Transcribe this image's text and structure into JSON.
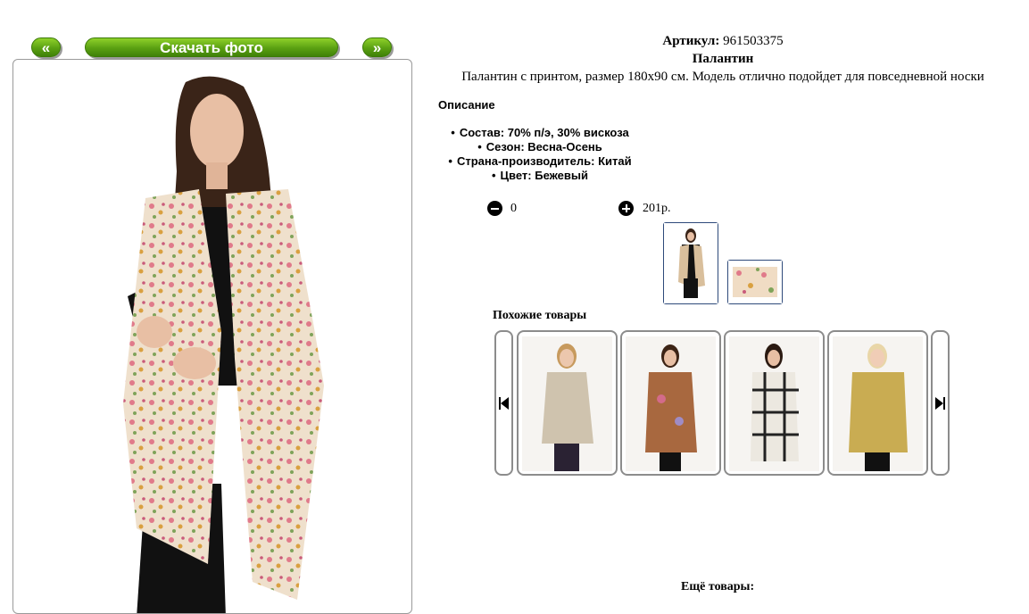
{
  "nav": {
    "prev_label": "«",
    "download_label": "Скачать фото",
    "next_label": "»"
  },
  "product": {
    "article_label": "Артикул:",
    "article_value": "961503375",
    "title": "Палантин",
    "description": "Палантин с принтом, размер 180х90 см. Модель отлично подойдет для повседневной носки",
    "description_heading": "Описание",
    "specs": [
      "Состав: 70% п/э, 30% вискоза",
      "Сезон: Весна-Осень",
      "Страна-производитель: Китай",
      "Цвет: Бежевый"
    ]
  },
  "order": {
    "quantity": "0",
    "price": "201р."
  },
  "icons": [
    "minus-circle-icon",
    "plus-circle-icon",
    "skip-back-icon",
    "skip-forward-icon"
  ],
  "colors": {
    "button_green": "#5aa012",
    "thumb_border": "#2e4a7a",
    "card_border": "#8c8c8c"
  },
  "similar": {
    "title": "Похожие товары"
  },
  "more": {
    "title": "Ещё товары:"
  }
}
